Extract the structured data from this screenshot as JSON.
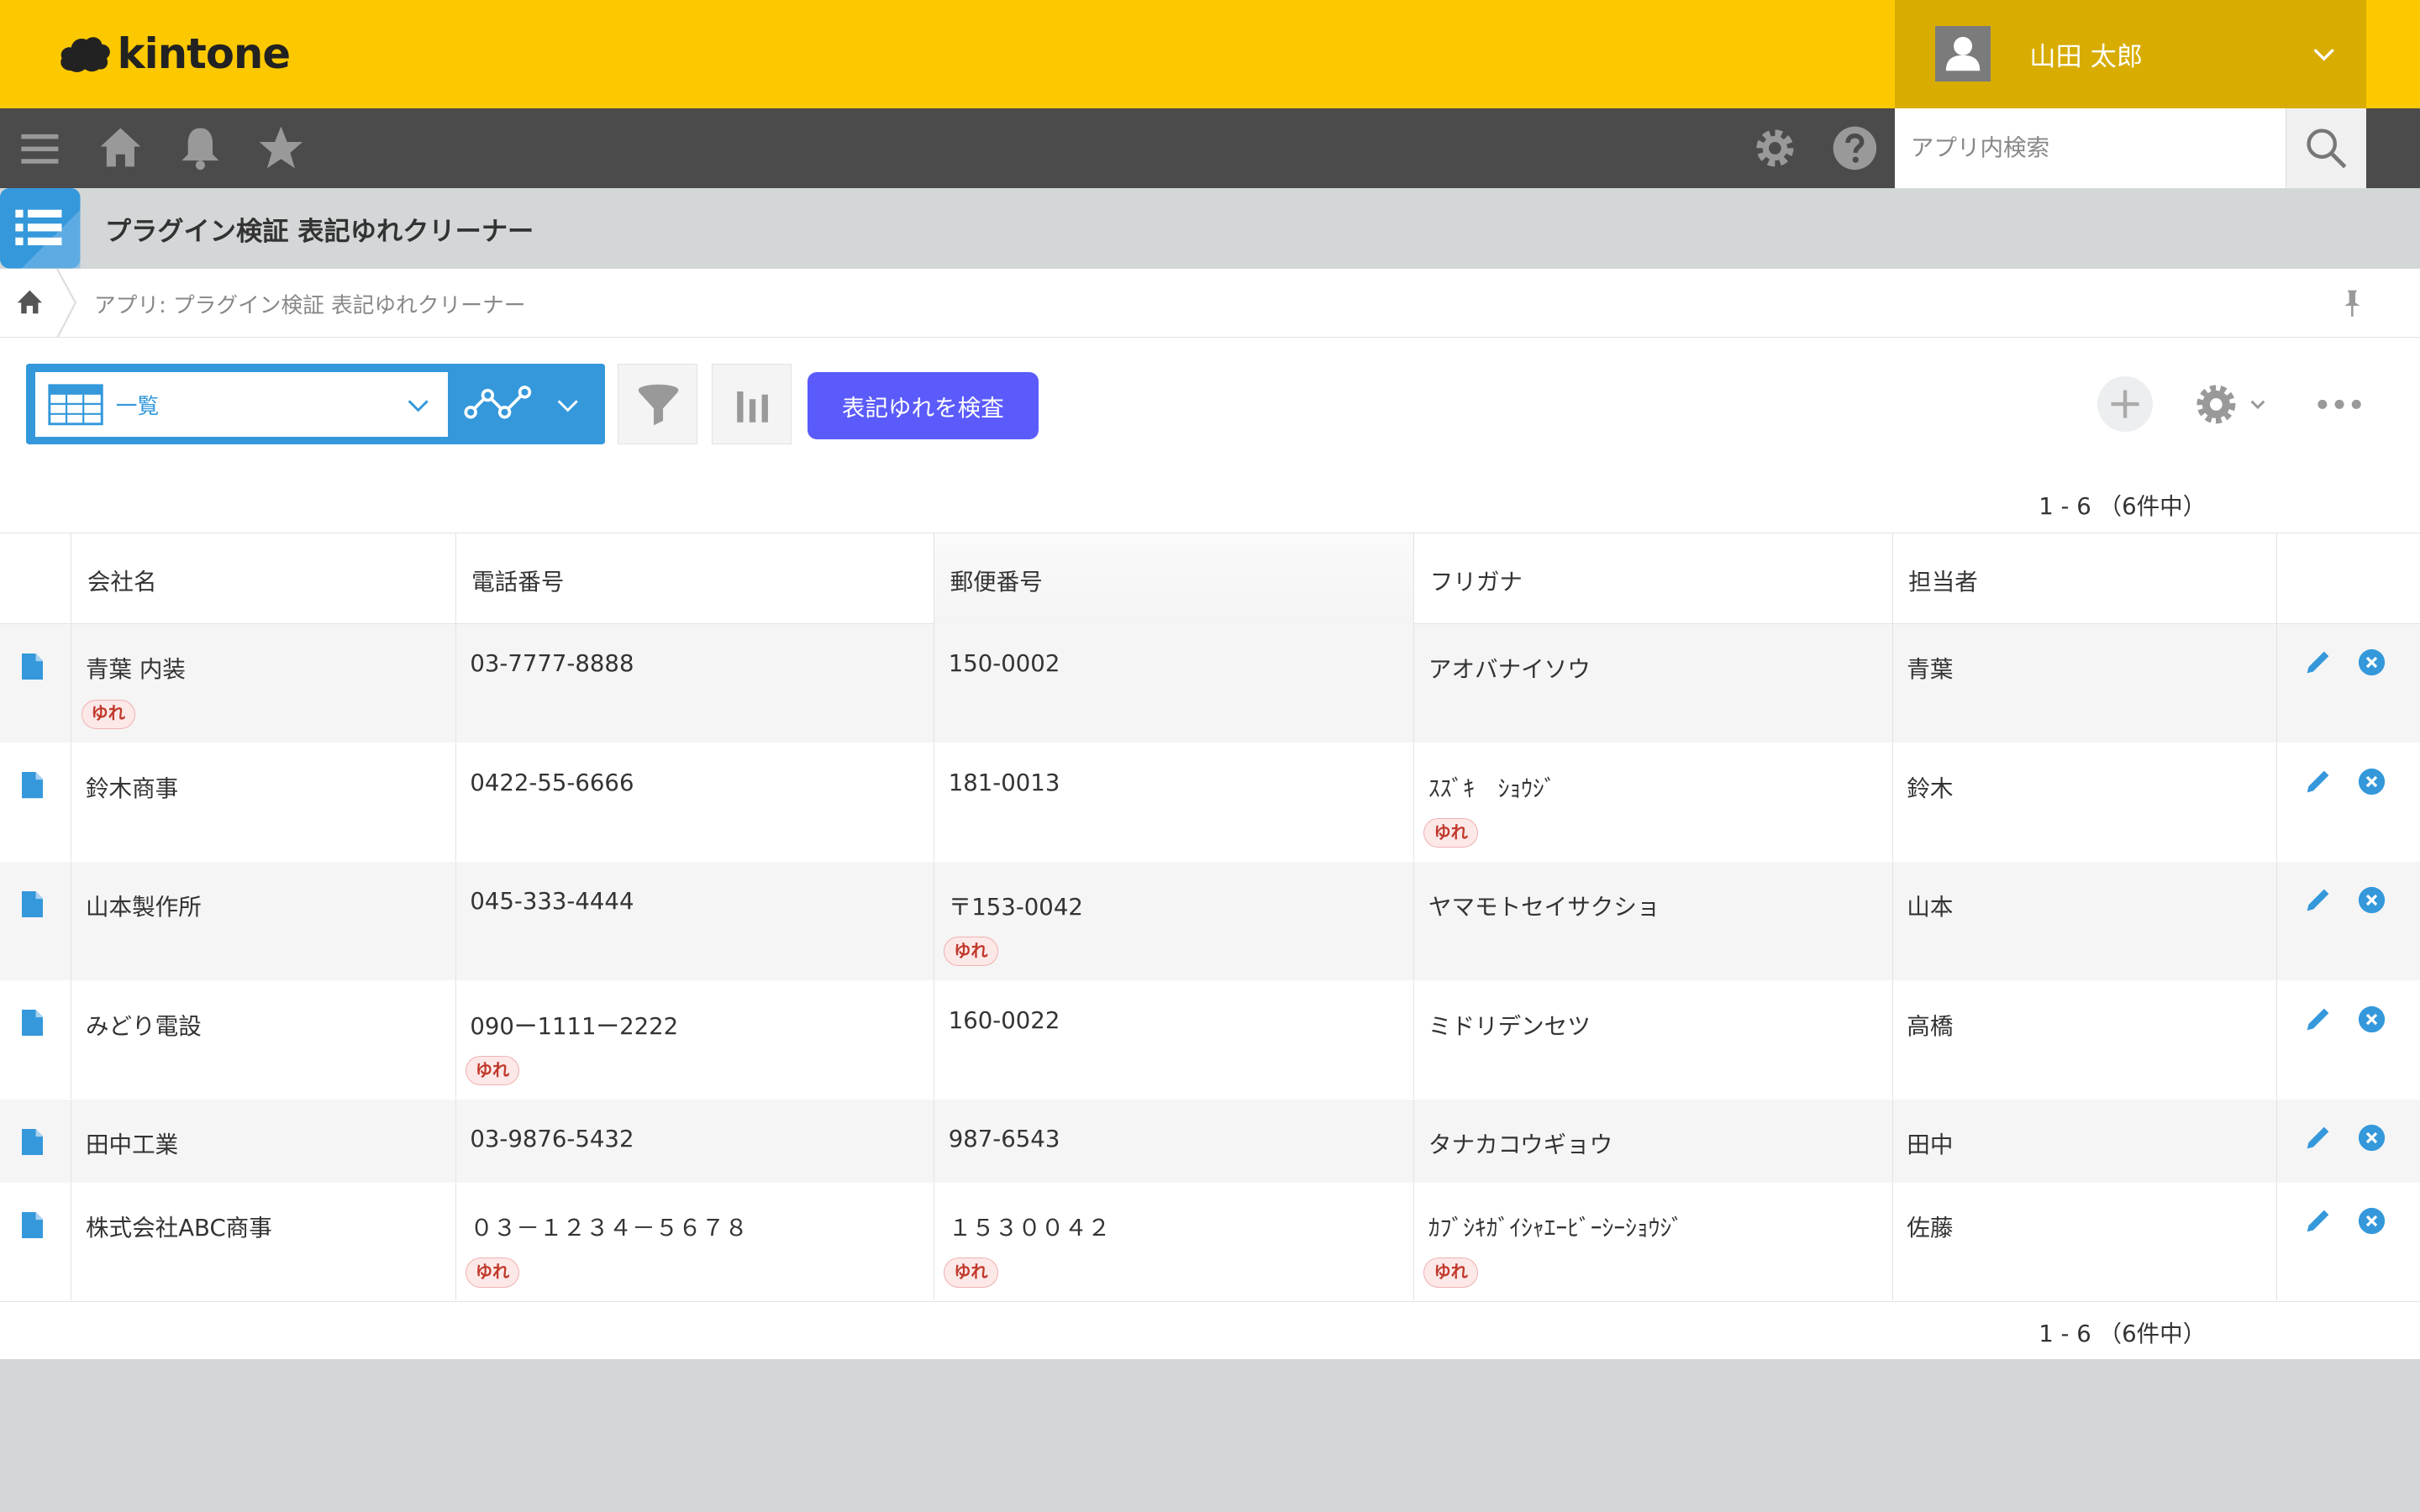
{
  "header": {
    "logo_text": "kintone",
    "user_name": "山田 太郎",
    "brand_color": "#fcc800"
  },
  "navbar": {
    "icons": [
      "menu-icon",
      "home-icon",
      "bell-icon",
      "star-icon",
      "gear-icon",
      "help-icon"
    ],
    "search_placeholder": "アプリ内検索"
  },
  "app": {
    "title": "プラグイン検証 表記ゆれクリーナー",
    "breadcrumb": "アプリ: プラグイン検証 表記ゆれクリーナー"
  },
  "toolbar": {
    "view_label": "一覧",
    "check_button": "表記ゆれを検査",
    "accent_color": "#3498db",
    "button_color": "#5b5bfb"
  },
  "pager": {
    "text": "1 - 6 （6件中）"
  },
  "table": {
    "columns": [
      "会社名",
      "電話番号",
      "郵便番号",
      "フリガナ",
      "担当者"
    ],
    "badge_label": "ゆれ",
    "rows": [
      {
        "company": "青葉 内装",
        "phone": "03-7777-8888",
        "zip": "150-0002",
        "kana": "アオバナイソウ",
        "person": "青葉"
      },
      {
        "company": "鈴木商事",
        "phone": "0422-55-6666",
        "zip": "181-0013",
        "kana": "ｽｽﾞｷ　ｼｮｳｼﾞ",
        "person": "鈴木"
      },
      {
        "company": "山本製作所",
        "phone": "045-333-4444",
        "zip": "〒153-0042",
        "kana": "ヤマモトセイサクショ",
        "person": "山本"
      },
      {
        "company": "みどり電設",
        "phone": "090ー1111ー2222",
        "zip": "160-0022",
        "kana": "ミドリデンセツ",
        "person": "高橋"
      },
      {
        "company": "田中工業",
        "phone": "03-9876-5432",
        "zip": "987-6543",
        "kana": "タナカコウギョウ",
        "person": "田中"
      },
      {
        "company": "株式会社ABC商事",
        "phone": "０３－１２３４－５６７８",
        "zip": "１５３００４２",
        "kana": "ｶﾌﾞｼｷｶﾞｲｼｬｴｰﾋﾞｰｼｰｼｮｳｼﾞ",
        "person": "佐藤"
      }
    ]
  }
}
